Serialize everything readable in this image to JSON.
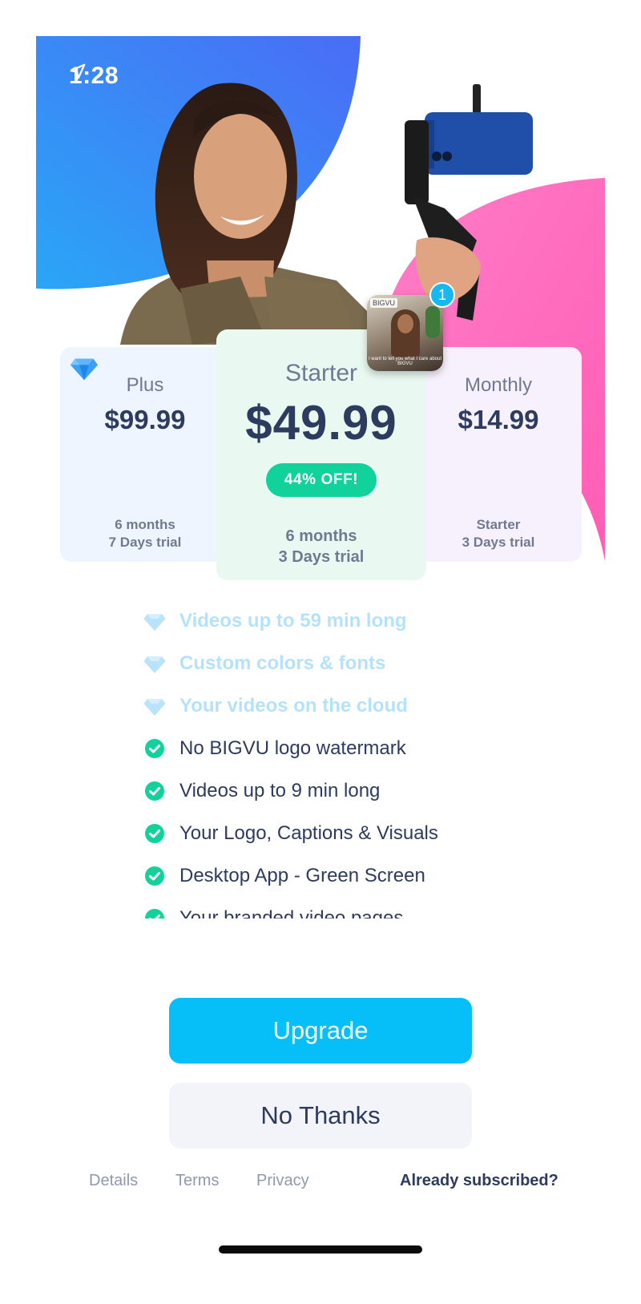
{
  "status_bar": {
    "time": "1:28",
    "location_icon": "location-arrow-icon"
  },
  "thumbnail": {
    "brand": "BIGVU",
    "caption": "I want to tell you what I care about BIGVU",
    "badge_count": "1"
  },
  "plans": [
    {
      "name": "Plus",
      "price": "$99.99",
      "duration": "6 months",
      "trial": "7 Days trial",
      "icon": "diamond-icon"
    },
    {
      "name": "Starter",
      "price": "$49.99",
      "discount": "44% OFF!",
      "duration": "6 months",
      "trial": "3 Days trial",
      "selected": true
    },
    {
      "name": "Monthly",
      "price": "$14.99",
      "duration": "Starter",
      "trial": "3 Days trial"
    }
  ],
  "features": [
    {
      "text": "Videos up to 59 min long",
      "icon": "diamond-icon",
      "premium": true
    },
    {
      "text": "Custom colors & fonts",
      "icon": "diamond-icon",
      "premium": true
    },
    {
      "text": "Your videos on the cloud",
      "icon": "diamond-icon",
      "premium": true
    },
    {
      "text": "No BIGVU logo watermark",
      "icon": "check-circle-icon",
      "premium": false
    },
    {
      "text": "Videos up to 9 min long",
      "icon": "check-circle-icon",
      "premium": false
    },
    {
      "text": "Your Logo, Captions & Visuals",
      "icon": "check-circle-icon",
      "premium": false
    },
    {
      "text": "Desktop App - Green Screen",
      "icon": "check-circle-icon",
      "premium": false
    },
    {
      "text": "Your branded video pages",
      "icon": "check-circle-icon",
      "premium": false
    }
  ],
  "buttons": {
    "upgrade": "Upgrade",
    "no_thanks": "No Thanks"
  },
  "footer": {
    "details": "Details",
    "terms": "Terms",
    "privacy": "Privacy",
    "already_subscribed": "Already subscribed?"
  },
  "colors": {
    "accent": "#06bff9",
    "discount_green": "#10d29a",
    "check_green": "#10d29a",
    "hero_blue": "#2f8cf5",
    "hero_pink": "#ff6fbe",
    "text_dark": "#2d3b5e"
  }
}
